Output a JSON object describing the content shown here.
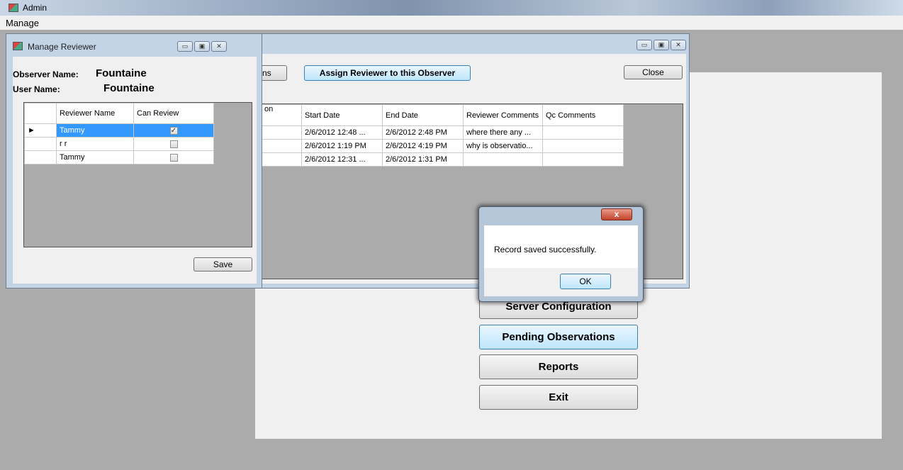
{
  "app": {
    "title": "Admin",
    "menu": [
      "Manage"
    ]
  },
  "main_buttons": {
    "server_configuration": "Server Configuration",
    "pending_observations": "Pending Observations",
    "reports": "Reports",
    "exit": "Exit"
  },
  "observations_window": {
    "partial_button_label": "ns",
    "assign_button": "Assign Reviewer to this Observer",
    "close_button": "Close",
    "columns": [
      "on",
      "Start Date",
      "End Date",
      "Reviewer Comments",
      "Qc Comments"
    ],
    "rows": [
      {
        "start": "2/6/2012 12:48 ...",
        "end": "2/6/2012 2:48 PM",
        "reviewer_comments": "where there  any ...",
        "qc_comments": ""
      },
      {
        "start": "2/6/2012 1:19 PM",
        "end": "2/6/2012 4:19 PM",
        "reviewer_comments": "why is observatio...",
        "qc_comments": ""
      },
      {
        "start": "2/6/2012 12:31 ...",
        "end": "2/6/2012 1:31 PM",
        "reviewer_comments": "",
        "qc_comments": ""
      }
    ]
  },
  "manage_reviewer": {
    "title": "Manage Reviewer",
    "observer_label": "Observer Name:",
    "observer_value": "Fountaine",
    "user_label": "User Name:",
    "user_value": "Fountaine",
    "columns": [
      "Reviewer Name",
      "Can Review"
    ],
    "rows": [
      {
        "name": "Tammy",
        "can_review": true,
        "selected": true
      },
      {
        "name": "r r",
        "can_review": false,
        "selected": false
      },
      {
        "name": "Tammy",
        "can_review": false,
        "selected": false
      }
    ],
    "save_button": "Save"
  },
  "message_box": {
    "close_glyph": "x",
    "message": "Record saved successfully.",
    "ok_button": "OK"
  }
}
